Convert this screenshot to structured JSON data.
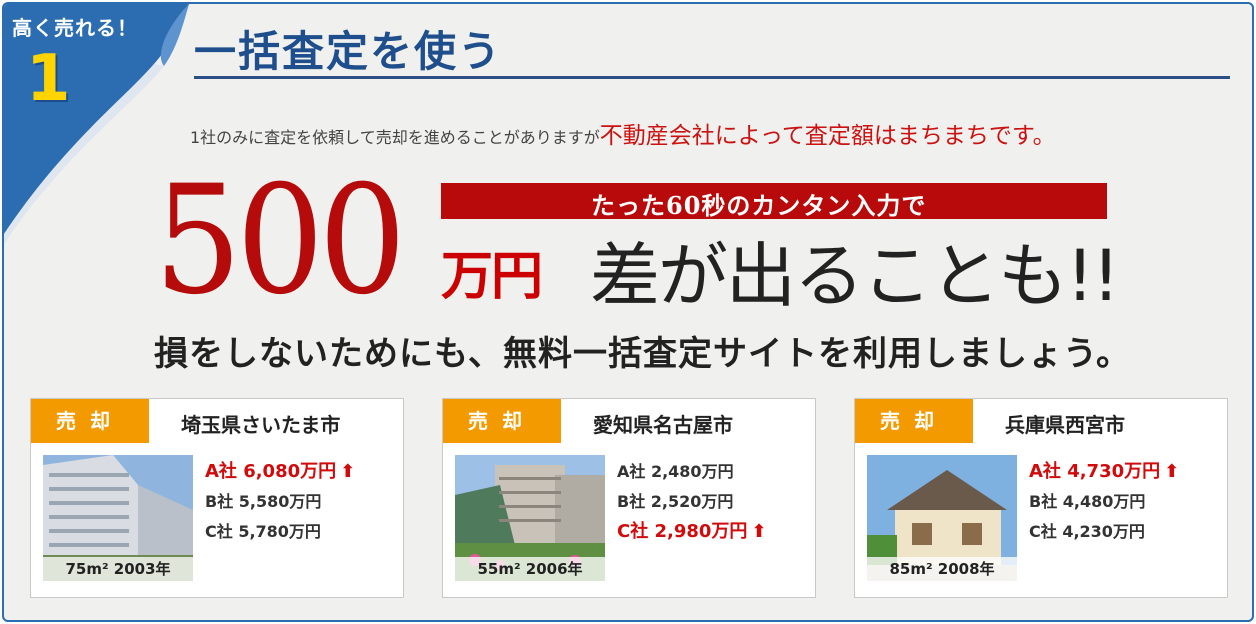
{
  "badge": {
    "label": "高く売れる！",
    "number": "1"
  },
  "heading": "一括査定を使う",
  "intro": {
    "normal": "1社のみに査定を依頼して売却を進めることがありますが",
    "highlight": "不動産会社によって査定額はまちまちです。"
  },
  "hero": {
    "number": "500",
    "banner": "たった60秒のカンタン入力で",
    "unit": "万円",
    "rest": "差が出ることも!!"
  },
  "subhead": "損をしないためにも、無料一括査定サイトを利用しましょう。",
  "cards": [
    {
      "tag": "売却",
      "city": "埼玉県さいたま市",
      "caption": "75m² 2003年",
      "quotes": [
        {
          "text": "A社 6,080万円",
          "highlight": true
        },
        {
          "text": "B社 5,580万円",
          "highlight": false
        },
        {
          "text": "C社 5,780万円",
          "highlight": false
        }
      ]
    },
    {
      "tag": "売却",
      "city": "愛知県名古屋市",
      "caption": "55m² 2006年",
      "quotes": [
        {
          "text": "A社 2,480万円",
          "highlight": false
        },
        {
          "text": "B社 2,520万円",
          "highlight": false
        },
        {
          "text": "C社 2,980万円",
          "highlight": true
        }
      ]
    },
    {
      "tag": "売却",
      "city": "兵庫県西宮市",
      "caption": "85m² 2008年",
      "quotes": [
        {
          "text": "A社 4,730万円",
          "highlight": true
        },
        {
          "text": "B社 4,480万円",
          "highlight": false
        },
        {
          "text": "C社 4,230万円",
          "highlight": false
        }
      ]
    }
  ],
  "colors": {
    "accent_blue": "#2c6db2",
    "heading_blue": "#1f4e8c",
    "red": "#b50b0b",
    "orange": "#f39a00",
    "gold": "#ffd400"
  },
  "icons": {
    "up_arrow": "up-arrow-icon"
  }
}
